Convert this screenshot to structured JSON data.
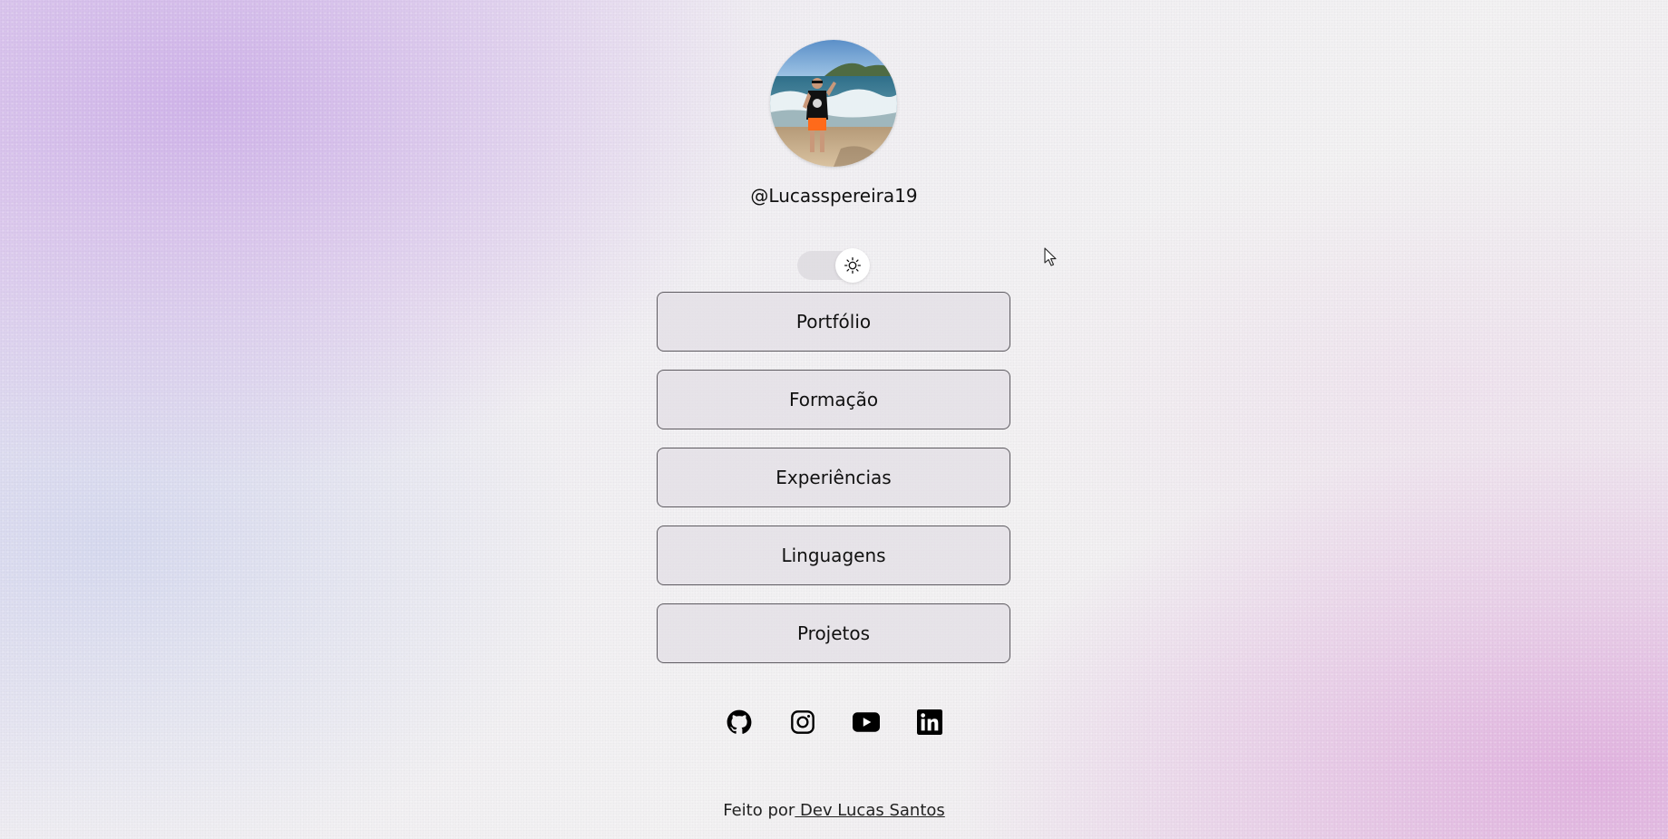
{
  "profile": {
    "username": "@Lucasspereira19",
    "avatar_icon": "profile-photo"
  },
  "theme_toggle": {
    "state": "light",
    "icon": "sun-icon"
  },
  "links": [
    {
      "label": "Portfólio"
    },
    {
      "label": "Formação"
    },
    {
      "label": "Experiências"
    },
    {
      "label": "Linguagens"
    },
    {
      "label": "Projetos"
    }
  ],
  "socials": [
    {
      "name": "github-icon"
    },
    {
      "name": "instagram-icon"
    },
    {
      "name": "youtube-icon"
    },
    {
      "name": "linkedin-icon"
    }
  ],
  "footer": {
    "prefix": "Feito por",
    "author_link": " Dev Lucas Santos"
  },
  "colors": {
    "button_border": "#5d5a60",
    "button_bg": "#e2dee4",
    "text": "#111111"
  }
}
